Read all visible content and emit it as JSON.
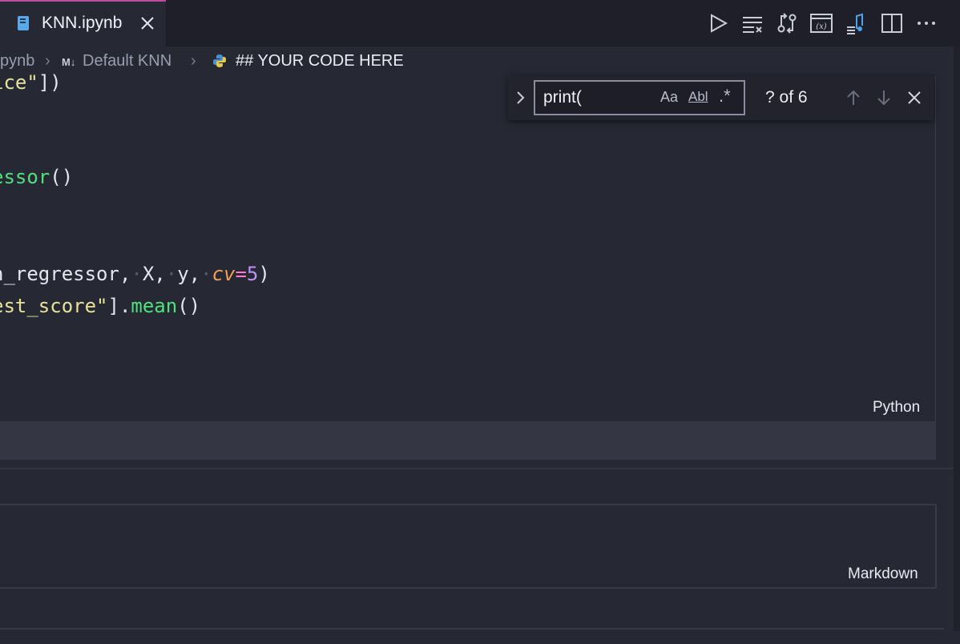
{
  "tab": {
    "title": "KNN.ipynb",
    "close_icon": "close-icon",
    "file_icon": "notebook-icon"
  },
  "toolbar": {
    "icons": [
      "run-all-icon",
      "clear-outputs-icon",
      "compare-icon",
      "variables-icon",
      "outline-icon",
      "split-editor-icon",
      "more-actions-icon"
    ],
    "accent": "#c04a9d"
  },
  "breadcrumb": {
    "file": "pynb",
    "md_badge": "M↓",
    "section": "Default KNN",
    "current": "## YOUR CODE HERE"
  },
  "code": {
    "line1": {
      "str": "ice\"",
      "rest": "])"
    },
    "line2": {
      "fn": "essor",
      "rest": "()"
    },
    "line3": {
      "a": "n_regressor,",
      "b": "X,",
      "c": "y,",
      "kw": "cv",
      "op": "=",
      "num": "5",
      "close": ")"
    },
    "line4": {
      "str": "est_score\"",
      "mid": "].",
      "fn": "mean",
      "rest": "()"
    },
    "language": "Python"
  },
  "markdown_cell": {
    "language": "Markdown"
  },
  "find": {
    "query": "print(",
    "match_case": "Aa",
    "whole_word": "Abl",
    "regex": ".*",
    "count": "? of 6"
  },
  "colors": {
    "string": "#e6e29a",
    "function": "#50e07c",
    "keyword_arg": "#f0a05a",
    "number": "#bd93f9"
  }
}
